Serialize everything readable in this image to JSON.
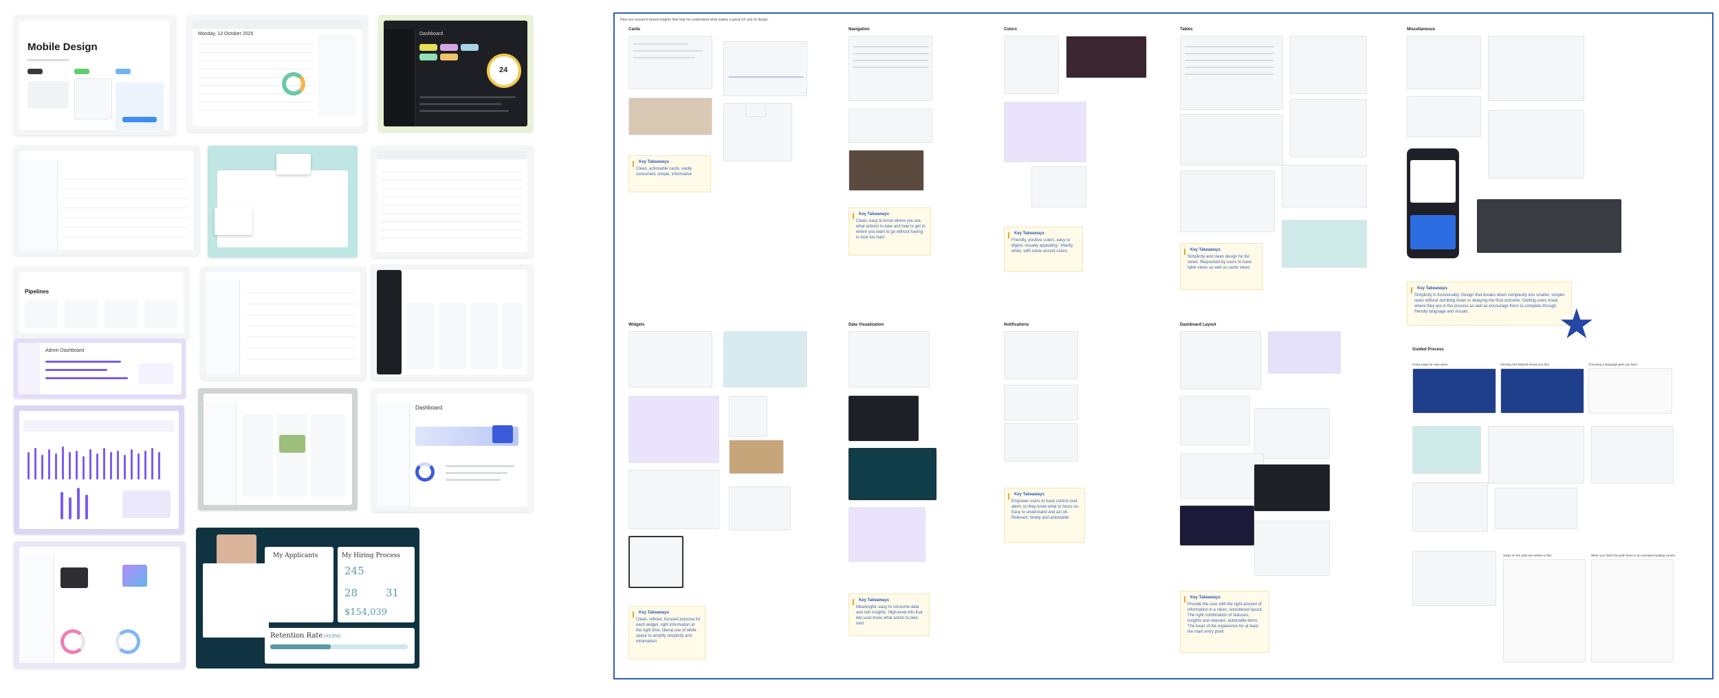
{
  "left_mosaic": {
    "mobile_design_title": "Mobile Design",
    "date_heading": "Monday, 13 October 2025",
    "dashboard_label": "Dashboard",
    "gauge_value": "24",
    "pipelines_label": "Pipelines",
    "admin_dashboard_label": "Admin Dashboard",
    "dashboard_label_2": "Dashboard",
    "applicants_heading": "My Applicants",
    "hiring_heading": "My Hiring Process",
    "hiring_stat_1": "245",
    "hiring_stat_2": "28",
    "hiring_stat_3": "31",
    "hiring_money": "$154,039",
    "retention_label": "Retention Rate",
    "retention_value": "(43.8%)"
  },
  "board": {
    "intro": "Here are research-based insights that help me understand what makes a great UX and UI design",
    "sections": {
      "cards": "Cards",
      "navigation": "Navigation",
      "colors": "Colors",
      "tables": "Tables",
      "miscellaneous": "Miscellaneous",
      "widgets": "Widgets",
      "data_visualization": "Data Visualization",
      "notifications": "Notifications",
      "dashboard_layout": "Dashboard Layout",
      "guided_process": "Guided Process"
    },
    "note_title": "Key Takeaways",
    "notes": {
      "cards": "Clean, actionable cards, easily consumed, simple, informative",
      "navigation": "Clean, easy to know where you are, what actions to take and how to get to where you want to go without having to look too hard",
      "colors": "Friendly, positive colors, easy to digest, visually appealing - Mainly white, with some accent colors",
      "tables": "Simplicity and clean design for list views. Requested by users to have table views as well as cards views",
      "miscellaneous": "Simplicity in functionality. Design that breaks down complexity into smaller, simpler tasks without dumbing down or delaying the final outcome. Getting users know where they are in the process as well as encourage them to complete through friendly language and visuals.",
      "widgets": "Clean, refined, focused purpose for each widget, right information at the right time, liberal use of white space to amplify simplicity and minimalism",
      "data_visualization": "Meaningful, easy to consume data and rich insights. High-level info that lets user know what action to take next",
      "notifications": "Empower users to have control over alerts so they know what to focus on. Easy to understand and act on. Relevant, timely and actionable",
      "dashboard_layout": "Provide the user with the right amount of information in a clean, uncluttered layout. The right combination of statuses, insights and relevant, actionable items. The heart of the experience for at least the main entry point"
    },
    "guided_captions": {
      "c1": "Home page for new users",
      "c2": "Clicking Get Started shows you this",
      "c3": "Choosing a language gets you here",
      "c4": "Steps on the path are similar to this",
      "c5": "When you finish the path there is an animated loading screen"
    }
  },
  "colors": {
    "board_border": "#2d5fb3",
    "note_background": "#fffbe8",
    "note_text": "#3a62c4",
    "accent_purple": "#7b5cf0",
    "accent_teal": "#bfe6e2",
    "star": "#2447a6"
  }
}
